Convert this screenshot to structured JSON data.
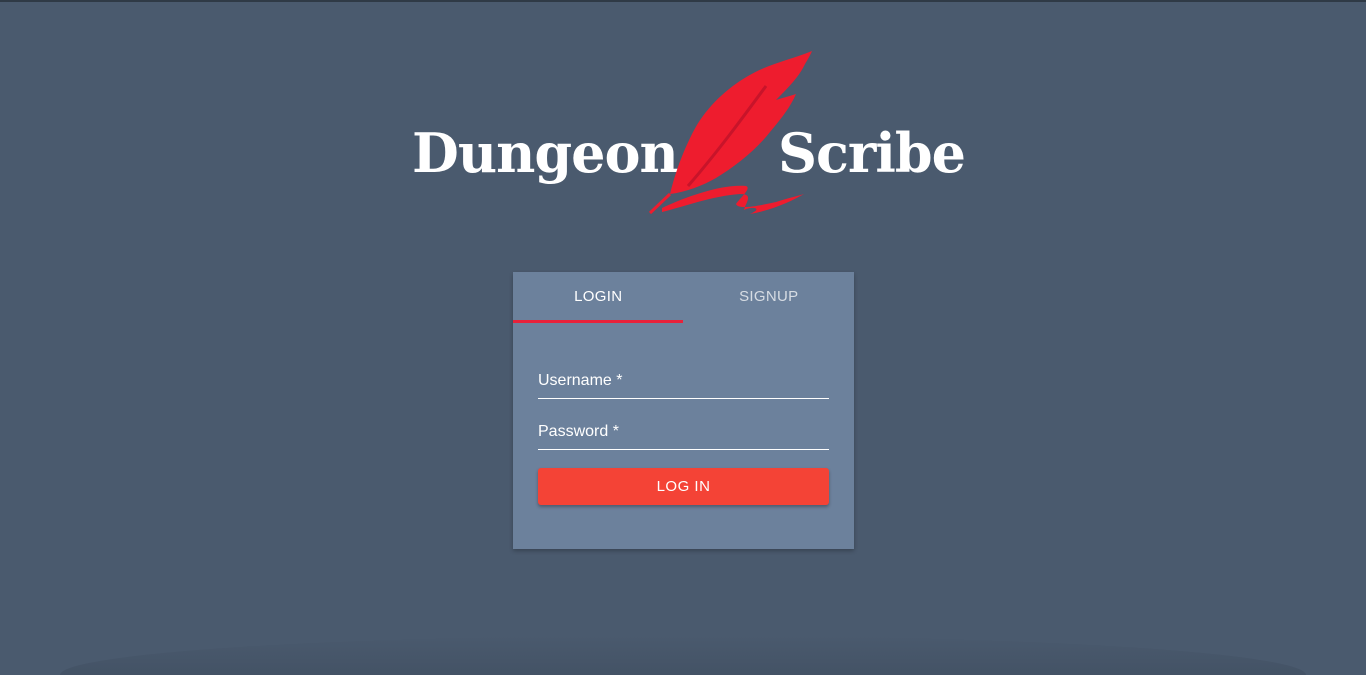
{
  "logo": {
    "left_word": "Dungeon",
    "right_word": "Scribe",
    "feather_color": "#ee1c2e"
  },
  "tabs": [
    {
      "label": "LOGIN",
      "active": true
    },
    {
      "label": "SIGNUP",
      "active": false
    }
  ],
  "form": {
    "username_label": "Username *",
    "username_value": "",
    "password_label": "Password *",
    "password_value": "",
    "submit_label": "LOG IN"
  },
  "colors": {
    "background": "#4a5a6e",
    "card": "#6c819c",
    "accent": "#e8213a",
    "button": "#f44336"
  }
}
